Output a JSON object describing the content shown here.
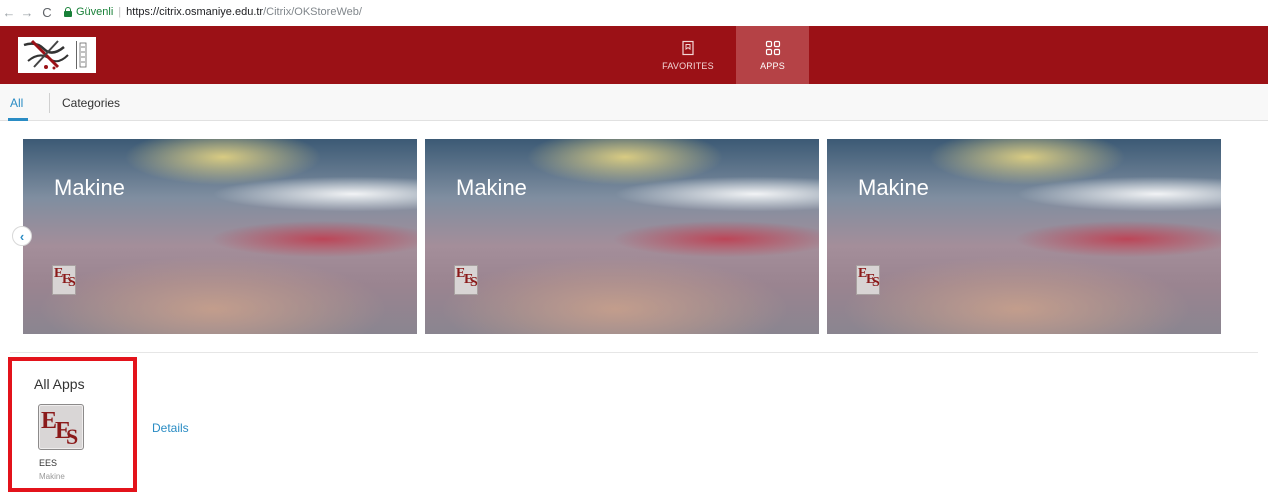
{
  "browser": {
    "back_icon": "arrow-left-icon",
    "back_glyph": "←",
    "forward_icon": "arrow-right-icon",
    "forward_glyph": "→",
    "reload_icon": "reload-icon",
    "reload_glyph": "C",
    "secure_label": "Güvenli",
    "url_separator": "|",
    "url_host": "https://citrix.osmaniye.edu.tr",
    "url_path": "/Citrix/OKStoreWeb/"
  },
  "header": {
    "background_color": "#9b1116",
    "tabs": [
      {
        "label": "FAVORITES",
        "icon": "bookmark-icon",
        "active": false
      },
      {
        "label": "APPS",
        "icon": "grid-icon",
        "active": true
      }
    ]
  },
  "subnav": {
    "items": [
      {
        "label": "All",
        "active": true
      },
      {
        "label": "Categories",
        "active": false
      }
    ],
    "accent_color": "#2a8cc4"
  },
  "carousel": {
    "prev_icon": "chevron-left-icon",
    "prev_glyph": "‹",
    "banners": [
      {
        "title": "Makine",
        "icon": "ees-app-icon"
      },
      {
        "title": "Makine",
        "icon": "ees-app-icon"
      },
      {
        "title": "Makine",
        "icon": "ees-app-icon"
      }
    ]
  },
  "ees_logo": {
    "e1": "E",
    "e2": "E",
    "s": "S"
  },
  "all_apps": {
    "title": "All Apps",
    "highlight_color": "#e3131b",
    "apps": [
      {
        "name": "EES",
        "category": "Makine",
        "details_label": "Details"
      }
    ]
  }
}
